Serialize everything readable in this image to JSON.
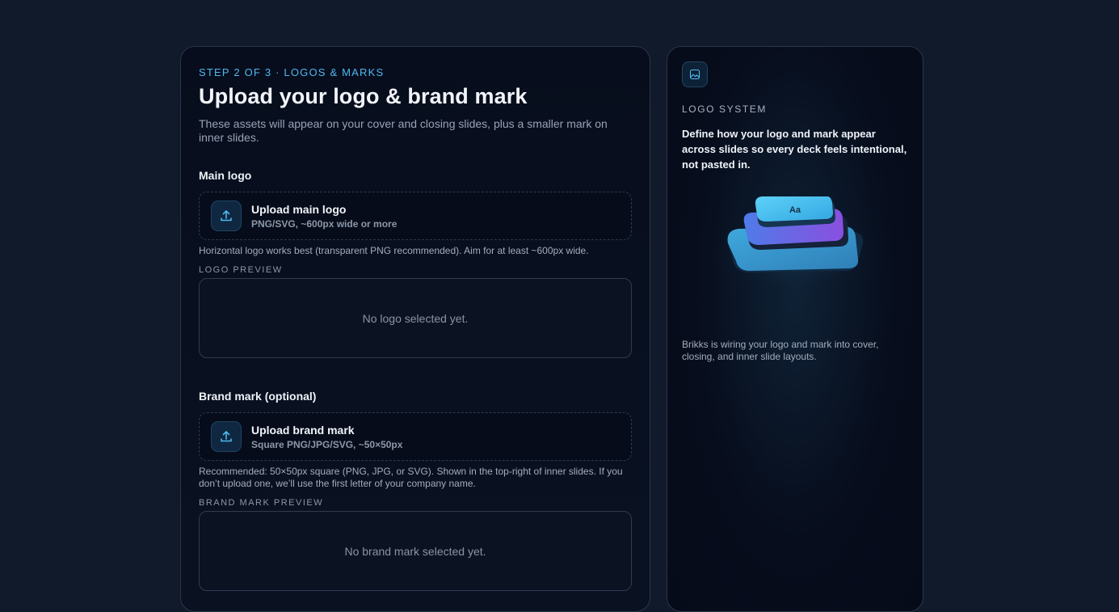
{
  "step": {
    "label": "STEP 2 OF 3 · LOGOS & MARKS"
  },
  "header": {
    "title": "Upload your logo & brand mark",
    "subtitle": "These assets will appear on your cover and closing slides, plus a smaller mark on inner slides."
  },
  "main_logo": {
    "section_title": "Main logo",
    "upload_title": "Upload main logo",
    "upload_hint": "PNG/SVG, ~600px wide or more",
    "help": "Horizontal logo works best (transparent PNG recommended). Aim for at least ~600px wide.",
    "preview_label": "LOGO PREVIEW",
    "preview_empty": "No logo selected yet."
  },
  "brand_mark": {
    "section_title": "Brand mark (optional)",
    "upload_title": "Upload brand mark",
    "upload_hint": "Square PNG/JPG/SVG, ~50×50px",
    "help": "Recommended: 50×50px square (PNG, JPG, or SVG). Shown in the top-right of inner slides. If you don’t upload one, we’ll use the first letter of your company name.",
    "preview_label": "BRAND MARK PREVIEW",
    "preview_empty": "No brand mark selected yet."
  },
  "sidebar": {
    "icon": "image-icon",
    "eyebrow": "LOGO SYSTEM",
    "lead": "Define how your logo and mark appear across slides so every deck feels intentional, not pasted in.",
    "illustration_text": "Aa",
    "footer": "Brikks is wiring your logo and mark into cover, closing, and inner slide layouts."
  },
  "colors": {
    "accent": "#4fb8f0",
    "background": "#111a2b",
    "card": "#070d1c"
  }
}
